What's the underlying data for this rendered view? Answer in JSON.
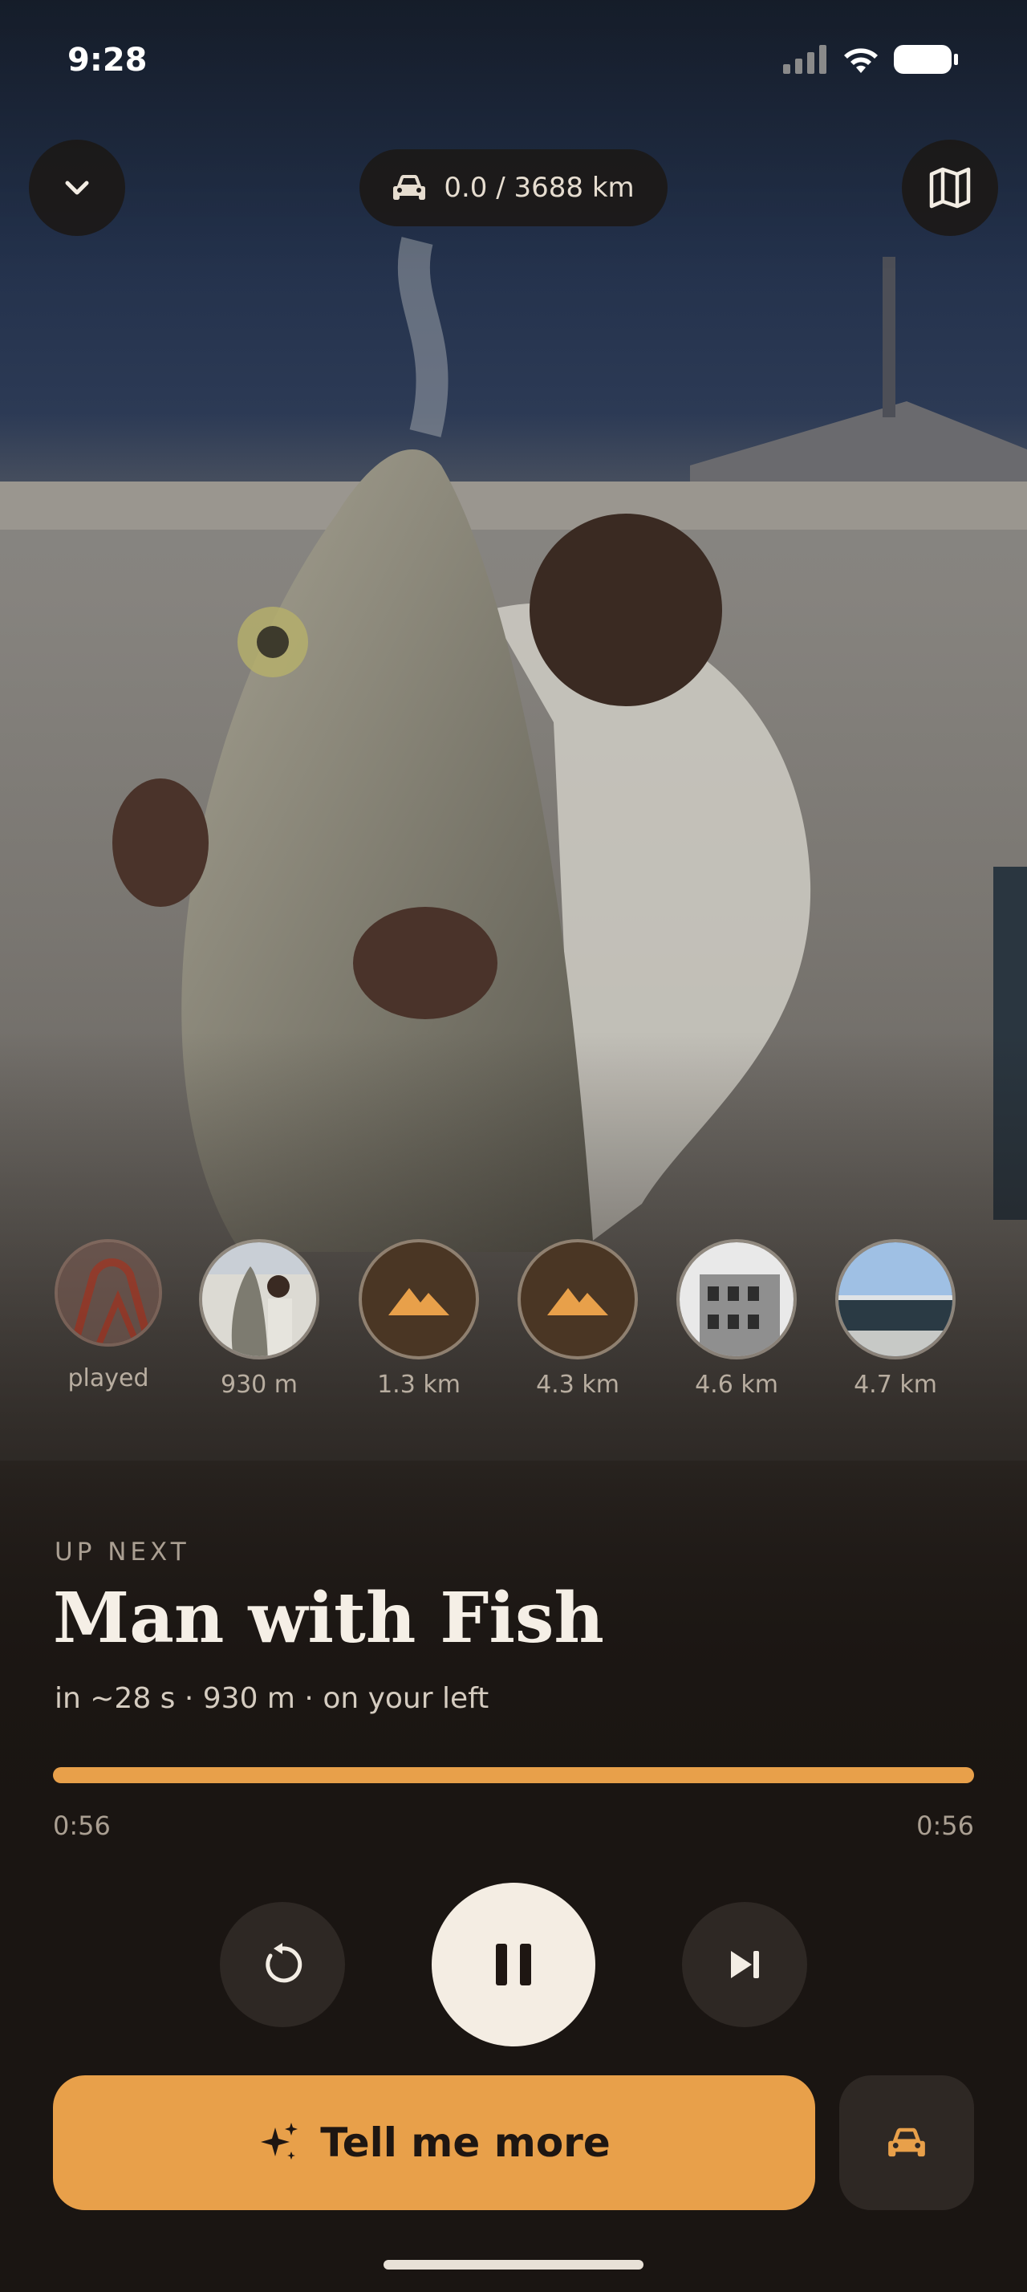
{
  "status_bar": {
    "time": "9:28"
  },
  "header": {
    "collapse_icon": "chevron-down-icon",
    "distance": "0.0 / 3688 km",
    "map_icon": "map-icon"
  },
  "stops": [
    {
      "label": "played",
      "image": "red-sculpture"
    },
    {
      "label": "930 m",
      "image": "man-with-fish"
    },
    {
      "label": "1.3 km",
      "image": "mountain-placeholder"
    },
    {
      "label": "4.3 km",
      "image": "mountain-placeholder"
    },
    {
      "label": "4.6 km",
      "image": "building-bw"
    },
    {
      "label": "4.7 km",
      "image": "glass-building"
    }
  ],
  "now_playing": {
    "eyebrow": "UP NEXT",
    "title": "Man with Fish",
    "subtitle": "in ~28 s · 930 m · on your left",
    "elapsed": "0:56",
    "duration": "0:56",
    "progress_fraction": 1.0
  },
  "controls": {
    "replay_icon": "replay-icon",
    "pause_icon": "pause-icon",
    "skip_icon": "skip-next-icon"
  },
  "cta": {
    "label": "Tell me more",
    "icon": "sparkle-icon"
  },
  "colors": {
    "accent": "#e8a04a",
    "background": "#1a1512"
  }
}
